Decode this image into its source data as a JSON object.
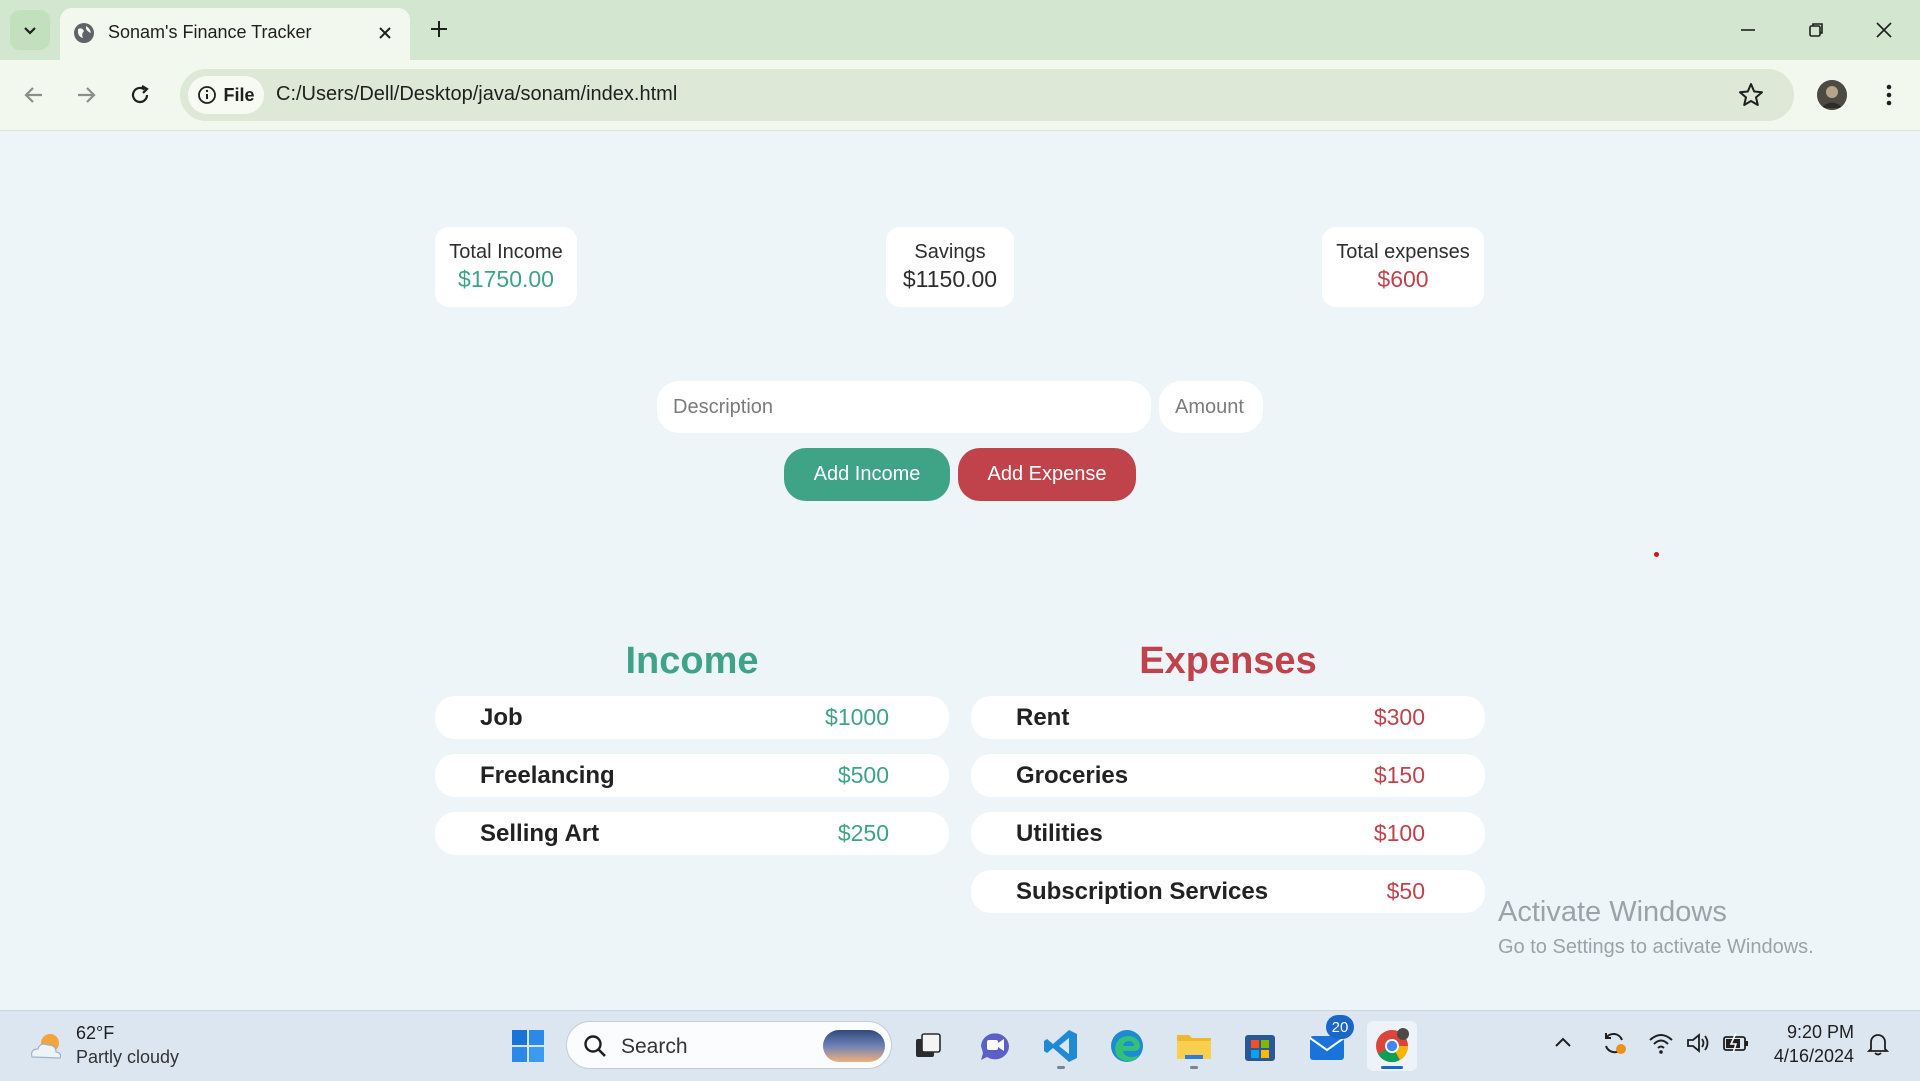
{
  "browser": {
    "tab_title": "Sonam's Finance Tracker",
    "site_info_label": "File",
    "url": "C:/Users/Dell/Desktop/java/sonam/index.html"
  },
  "summary": {
    "income": {
      "label": "Total Income",
      "value": "$1750.00"
    },
    "savings": {
      "label": "Savings",
      "value": "$1150.00"
    },
    "expenses": {
      "label": "Total expenses",
      "value": "$600"
    }
  },
  "form": {
    "description_placeholder": "Description",
    "amount_placeholder": "Amount",
    "add_income_label": "Add Income",
    "add_expense_label": "Add Expense"
  },
  "income": {
    "title": "Income",
    "items": [
      {
        "name": "Job",
        "amount": "$1000"
      },
      {
        "name": "Freelancing",
        "amount": "$500"
      },
      {
        "name": "Selling Art",
        "amount": "$250"
      }
    ]
  },
  "expenses": {
    "title": "Expenses",
    "items": [
      {
        "name": "Rent",
        "amount": "$300"
      },
      {
        "name": "Groceries",
        "amount": "$150"
      },
      {
        "name": "Utilities",
        "amount": "$100"
      },
      {
        "name": "Subscription Services",
        "amount": "$50"
      }
    ]
  },
  "watermark": {
    "line1": "Activate Windows",
    "line2": "Go to Settings to activate Windows."
  },
  "taskbar": {
    "weather_temp": "62°F",
    "weather_condition": "Partly cloudy",
    "search_label": "Search",
    "mail_badge": "20",
    "time": "9:20 PM",
    "date": "4/16/2024"
  },
  "colors": {
    "income_green": "#3fa386",
    "expense_red": "#c0424b",
    "page_background": "#eef5f8"
  },
  "icons": [
    "tab-list-icon",
    "globe-icon",
    "close-icon",
    "plus-icon",
    "minimize-icon",
    "restore-icon",
    "back-icon",
    "forward-icon",
    "reload-icon",
    "info-icon",
    "star-icon",
    "kebab-menu-icon",
    "weather-icon",
    "windows-start-icon",
    "search-icon",
    "task-view-icon",
    "chat-icon",
    "vscode-icon",
    "edge-icon",
    "file-explorer-icon",
    "store-icon",
    "mail-icon",
    "chrome-icon",
    "chevron-up-icon",
    "sync-icon",
    "wifi-icon",
    "volume-icon",
    "battery-icon",
    "bell-icon"
  ]
}
